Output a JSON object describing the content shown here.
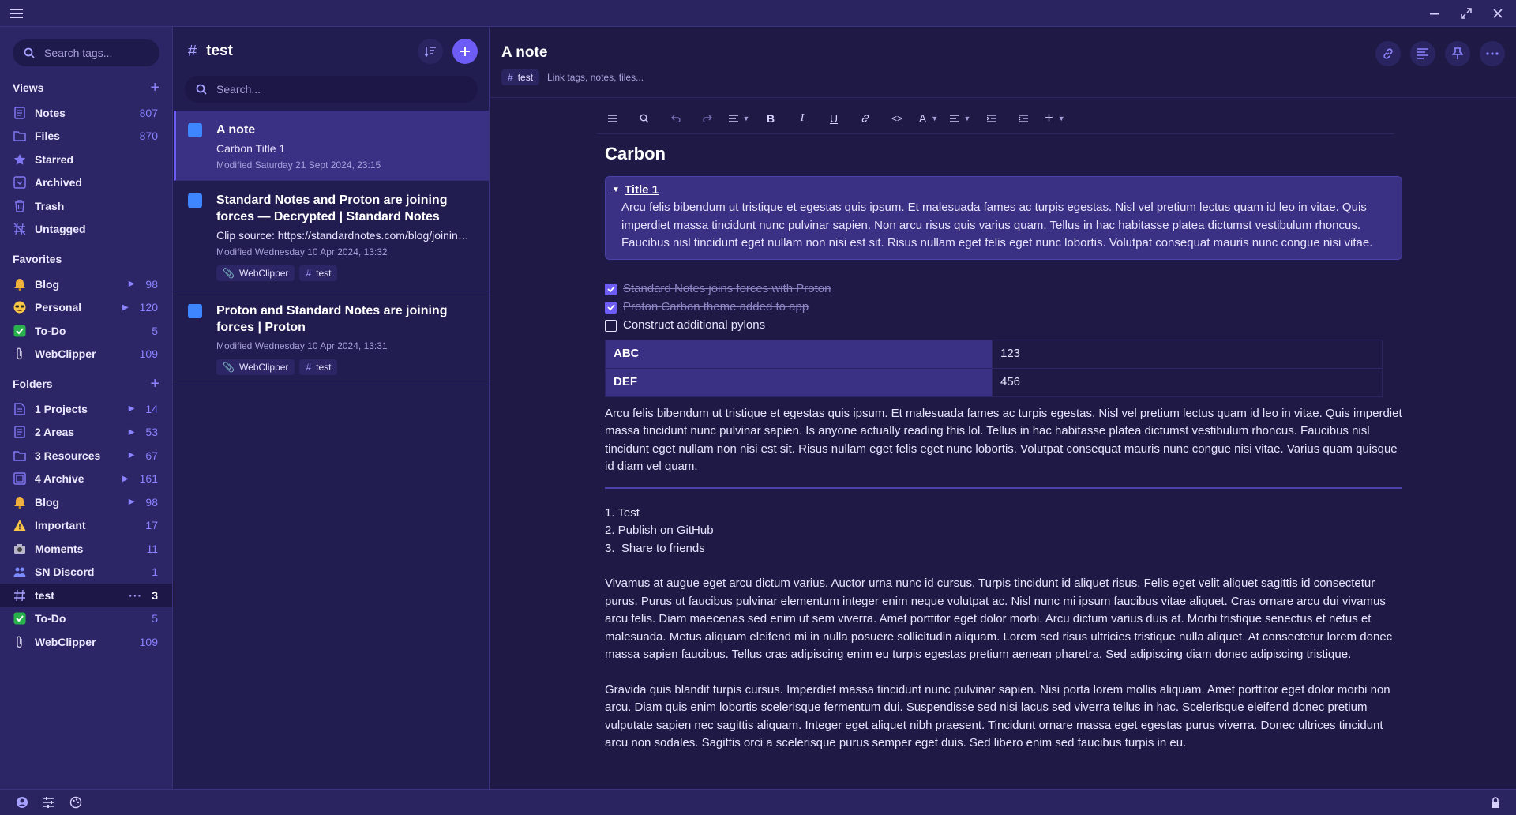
{
  "colors": {
    "accent": "#6d5cf5",
    "sidebar_bg": "#2c2566",
    "list_bg": "#221d50",
    "editor_bg": "#1e1a45",
    "count": "#8b83ff"
  },
  "window": {
    "menu_icon": "hamburger-icon",
    "controls": [
      "minimize-icon",
      "maximize-icon",
      "close-icon"
    ]
  },
  "sidebar": {
    "search_placeholder": "Search tags...",
    "views_title": "Views",
    "views": [
      {
        "label": "Notes",
        "count": "807",
        "icon": "notes-icon"
      },
      {
        "label": "Files",
        "count": "870",
        "icon": "folder-icon"
      },
      {
        "label": "Starred",
        "count": "",
        "icon": "star-icon"
      },
      {
        "label": "Archived",
        "count": "",
        "icon": "archive-icon"
      },
      {
        "label": "Trash",
        "count": "",
        "icon": "trash-icon"
      },
      {
        "label": "Untagged",
        "count": "",
        "icon": "untagged-icon"
      }
    ],
    "favorites_title": "Favorites",
    "favorites": [
      {
        "label": "Blog",
        "count": "98",
        "icon": "bell-emoji-icon"
      },
      {
        "label": "Personal",
        "count": "120",
        "icon": "sunglasses-emoji-icon"
      },
      {
        "label": "To-Do",
        "count": "5",
        "icon": "check-emoji-icon"
      },
      {
        "label": "WebClipper",
        "count": "109",
        "icon": "paperclip-emoji-icon"
      }
    ],
    "folders_title": "Folders",
    "folders": [
      {
        "label": "1 Projects",
        "count": "14",
        "icon": "document-icon"
      },
      {
        "label": "2 Areas",
        "count": "53",
        "icon": "notes-icon"
      },
      {
        "label": "3 Resources",
        "count": "67",
        "icon": "folder-icon"
      },
      {
        "label": "4 Archive",
        "count": "161",
        "icon": "archive-box-icon"
      },
      {
        "label": "Blog",
        "count": "98",
        "icon": "bell-emoji-icon"
      },
      {
        "label": "Important",
        "count": "17",
        "icon": "warning-emoji-icon"
      },
      {
        "label": "Moments",
        "count": "11",
        "icon": "camera-emoji-icon"
      },
      {
        "label": "SN Discord",
        "count": "1",
        "icon": "people-emoji-icon"
      },
      {
        "label": "test",
        "count": "3",
        "icon": "hash-icon"
      },
      {
        "label": "To-Do",
        "count": "5",
        "icon": "check-emoji-icon"
      },
      {
        "label": "WebClipper",
        "count": "109",
        "icon": "paperclip-emoji-icon"
      }
    ],
    "active_dots": "···"
  },
  "notelist": {
    "title": "test",
    "search_placeholder": "Search...",
    "notes": [
      {
        "title": "A note",
        "preview": "Carbon Title 1",
        "date": "Modified Saturday 21 Sept 2024, 23:15",
        "tags": []
      },
      {
        "title": "Standard Notes and Proton are joining forces — Decrypted | Standard Notes",
        "preview": "Clip source: https://standardnotes.com/blog/joining-forces-with-proton",
        "date": "Modified Wednesday 10 Apr 2024, 13:32",
        "tags": [
          "WebClipper",
          "test"
        ]
      },
      {
        "title": "Proton and Standard Notes are joining forces | Proton",
        "preview": "",
        "date": "Modified Wednesday 10 Apr 2024, 13:31",
        "tags": [
          "WebClipper",
          "test"
        ]
      }
    ]
  },
  "editor": {
    "title": "A note",
    "tag": "test",
    "tag_hint": "Link tags, notes, files...",
    "toolbar": {
      "items": [
        "menu",
        "search",
        "undo",
        "redo",
        "paragraph",
        "bold",
        "italic",
        "underline",
        "link",
        "code",
        "text-color",
        "align",
        "indent",
        "outdent",
        "insert"
      ],
      "bold": "B",
      "italic": "I",
      "underline": "U",
      "code": "<>",
      "text_color": "A",
      "insert": "+"
    },
    "heading": "Carbon",
    "callout": {
      "title": "Title 1",
      "text": "Arcu felis bibendum ut tristique et egestas quis ipsum. Et malesuada fames ac turpis egestas. Nisl vel pretium lectus quam id leo in vitae. Quis imperdiet massa tincidunt nunc pulvinar sapien. Non arcu risus quis varius quam. Tellus in hac habitasse platea dictumst vestibulum rhoncus. Faucibus nisl tincidunt eget nullam non nisi est sit. Risus nullam eget felis eget nunc lobortis. Volutpat consequat mauris nunc congue nisi vitae."
    },
    "checklist": [
      {
        "label": "Standard Notes joins forces with Proton",
        "checked": true
      },
      {
        "label": "Proton Carbon theme added to app",
        "checked": true
      },
      {
        "label": "Construct additional pylons",
        "checked": false
      }
    ],
    "table": [
      {
        "key": "ABC",
        "value": "123"
      },
      {
        "key": "DEF",
        "value": "456"
      }
    ],
    "paragraph1": "Arcu felis bibendum ut tristique et egestas quis ipsum. Et malesuada fames ac turpis egestas. Nisl vel pretium lectus quam id leo in vitae. Quis imperdiet massa tincidunt nunc pulvinar sapien. Is anyone actually reading this lol. Tellus in hac habitasse platea dictumst vestibulum rhoncus. Faucibus nisl tincidunt eget nullam non nisi est sit. Risus nullam eget felis eget nunc lobortis. Volutpat consequat mauris nunc congue nisi vitae. Varius quam quisque id diam vel quam.",
    "ordered_list": [
      "1. Test",
      "2. Publish on GitHub",
      "3.  Share to friends"
    ],
    "paragraph2": "Vivamus at augue eget arcu dictum varius. Auctor urna nunc id cursus. Turpis tincidunt id aliquet risus. Felis eget velit aliquet sagittis id consectetur purus. Purus ut faucibus pulvinar elementum integer enim neque volutpat ac. Nisl nunc mi ipsum faucibus vitae aliquet. Cras ornare arcu dui vivamus arcu felis. Diam maecenas sed enim ut sem viverra. Amet porttitor eget dolor morbi. Arcu dictum varius duis at. Morbi tristique senectus et netus et malesuada. Metus aliquam eleifend mi in nulla posuere sollicitudin aliquam. Lorem sed risus ultricies tristique nulla aliquet. At consectetur lorem donec massa sapien faucibus. Tellus cras adipiscing enim eu turpis egestas pretium aenean pharetra. Sed adipiscing diam donec adipiscing tristique.",
    "paragraph3": "Gravida quis blandit turpis cursus. Imperdiet massa tincidunt nunc pulvinar sapien. Nisi porta lorem mollis aliquam. Amet porttitor eget dolor morbi non arcu. Diam quis enim lobortis scelerisque fermentum dui. Suspendisse sed nisi lacus sed viverra tellus in hac. Scelerisque eleifend donec pretium vulputate sapien nec sagittis aliquam. Integer eget aliquet nibh praesent. Tincidunt ornare massa eget egestas purus viverra. Donec ultrices tincidunt arcu non sodales. Sagittis orci a scelerisque purus semper eget duis. Sed libero enim sed faucibus turpis in eu."
  },
  "statusbar": {
    "icons": [
      "account-icon",
      "preferences-icon",
      "themes-icon",
      "lock-icon"
    ]
  }
}
